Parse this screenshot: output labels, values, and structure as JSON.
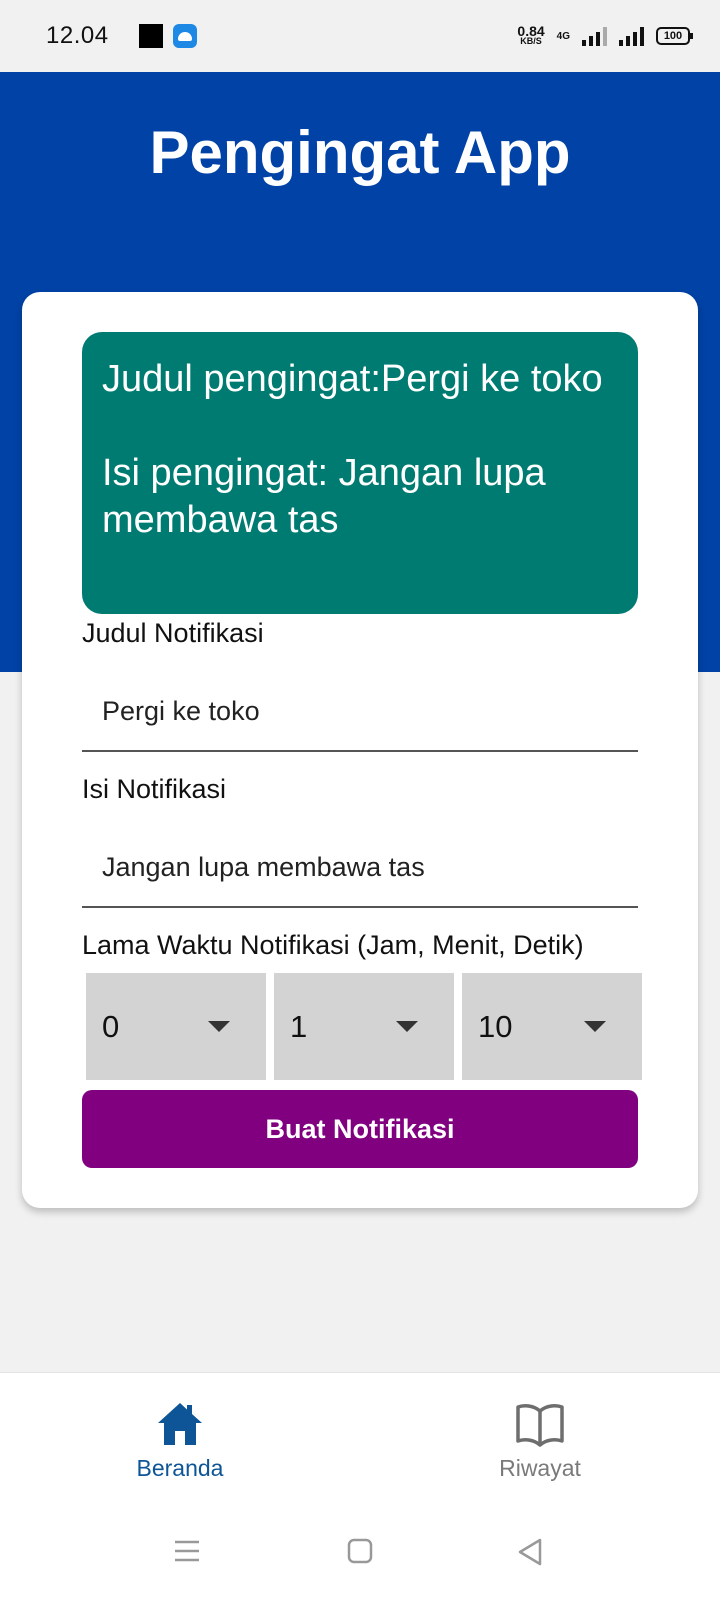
{
  "status_bar": {
    "time": "12.04",
    "net_speed_value": "0.84",
    "net_speed_unit": "KB/S",
    "network_type": "4G",
    "battery": "100"
  },
  "app": {
    "title": "Pengingat App"
  },
  "preview": {
    "title_line": "Judul pengingat:Pergi ke toko",
    "body_line": "Isi pengingat: Jangan lupa membawa tas"
  },
  "form": {
    "title_label": "Judul Notifikasi",
    "title_value": "Pergi ke toko",
    "body_label": "Isi Notifikasi",
    "body_value": "Jangan lupa membawa tas",
    "duration_label": "Lama Waktu Notifikasi (Jam, Menit, Detik)",
    "hours_value": "0",
    "minutes_value": "1",
    "seconds_value": "10",
    "submit_label": "Buat Notifikasi"
  },
  "bottom_nav": {
    "home_label": "Beranda",
    "history_label": "Riwayat",
    "active": "home",
    "home_icon": "home-icon",
    "history_icon": "book-icon",
    "active_color": "#0d5596",
    "inactive_color": "#7a7a7a"
  },
  "colors": {
    "header": "#0042a6",
    "preview_card": "#007b72",
    "button": "#800080",
    "dropdown": "#d3d3d3"
  }
}
